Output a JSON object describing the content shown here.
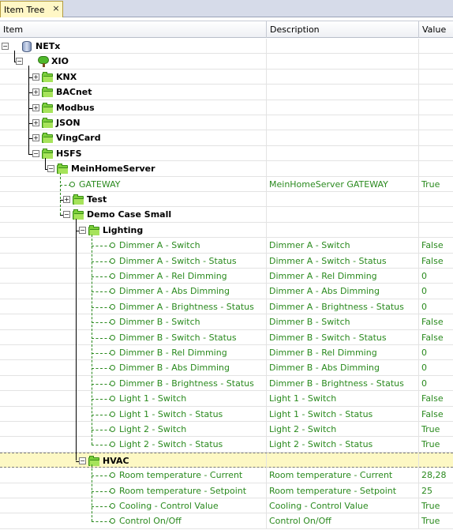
{
  "tab": {
    "title": "Item Tree",
    "close_glyph": "×"
  },
  "columns": {
    "item": "Item",
    "description": "Description",
    "value": "Value"
  },
  "rows": [
    {
      "label": "NETx",
      "desc": "",
      "value": "",
      "kind": "db",
      "level": 0,
      "expander": "−"
    },
    {
      "label": "XIO",
      "desc": "",
      "value": "",
      "kind": "tree",
      "level": 1,
      "expander": "−"
    },
    {
      "label": "KNX",
      "desc": "",
      "value": "",
      "kind": "folder",
      "level": 2,
      "expander": "+"
    },
    {
      "label": "BACnet",
      "desc": "",
      "value": "",
      "kind": "folder",
      "level": 2,
      "expander": "+"
    },
    {
      "label": "Modbus",
      "desc": "",
      "value": "",
      "kind": "folder",
      "level": 2,
      "expander": "+"
    },
    {
      "label": "JSON",
      "desc": "",
      "value": "",
      "kind": "folder",
      "level": 2,
      "expander": "+"
    },
    {
      "label": "VingCard",
      "desc": "",
      "value": "",
      "kind": "folder",
      "level": 2,
      "expander": "+"
    },
    {
      "label": "HSFS",
      "desc": "",
      "value": "",
      "kind": "folder",
      "level": 2,
      "expander": "−"
    },
    {
      "label": "MeinHomeServer",
      "desc": "",
      "value": "",
      "kind": "folder",
      "level": 3,
      "expander": "−"
    },
    {
      "label": "GATEWAY",
      "desc": "MeinHomeServer GATEWAY",
      "value": "True",
      "kind": "point",
      "level": 4
    },
    {
      "label": "Test",
      "desc": "",
      "value": "",
      "kind": "folder",
      "level": 4,
      "expander": "+"
    },
    {
      "label": "Demo Case Small",
      "desc": "",
      "value": "",
      "kind": "folder",
      "level": 4,
      "expander": "−"
    },
    {
      "label": "Lighting",
      "desc": "",
      "value": "",
      "kind": "folder",
      "level": 5,
      "expander": "−"
    },
    {
      "label": "Dimmer A - Switch",
      "desc": "Dimmer A - Switch",
      "value": "False",
      "kind": "point",
      "level": 6
    },
    {
      "label": "Dimmer A - Switch - Status",
      "desc": "Dimmer A - Switch - Status",
      "value": "False",
      "kind": "point",
      "level": 6
    },
    {
      "label": "Dimmer A - Rel Dimming",
      "desc": "Dimmer A - Rel Dimming",
      "value": "0",
      "kind": "point",
      "level": 6
    },
    {
      "label": "Dimmer A - Abs Dimming",
      "desc": "Dimmer A - Abs Dimming",
      "value": "0",
      "kind": "point",
      "level": 6
    },
    {
      "label": "Dimmer A - Brightness - Status",
      "desc": "Dimmer A - Brightness - Status",
      "value": "0",
      "kind": "point",
      "level": 6
    },
    {
      "label": "Dimmer B - Switch",
      "desc": "Dimmer B - Switch",
      "value": "False",
      "kind": "point",
      "level": 6
    },
    {
      "label": "Dimmer B - Switch - Status",
      "desc": "Dimmer B - Switch - Status",
      "value": "False",
      "kind": "point",
      "level": 6
    },
    {
      "label": "Dimmer B - Rel Dimming",
      "desc": "Dimmer B - Rel Dimming",
      "value": "0",
      "kind": "point",
      "level": 6
    },
    {
      "label": "Dimmer B - Abs Dimming",
      "desc": "Dimmer B - Abs Dimming",
      "value": "0",
      "kind": "point",
      "level": 6
    },
    {
      "label": "Dimmer B - Brightness - Status",
      "desc": "Dimmer B - Brightness - Status",
      "value": "0",
      "kind": "point",
      "level": 6
    },
    {
      "label": "Light 1 - Switch",
      "desc": "Light 1 - Switch",
      "value": "False",
      "kind": "point",
      "level": 6
    },
    {
      "label": "Light 1 - Switch - Status",
      "desc": "Light 1 - Switch - Status",
      "value": "False",
      "kind": "point",
      "level": 6
    },
    {
      "label": "Light 2 - Switch",
      "desc": "Light 2 - Switch",
      "value": "True",
      "kind": "point",
      "level": 6
    },
    {
      "label": "Light 2 - Switch - Status",
      "desc": "Light 2 - Switch - Status",
      "value": "True",
      "kind": "point",
      "level": 6
    },
    {
      "label": "HVAC",
      "desc": "",
      "value": "",
      "kind": "folder",
      "level": 5,
      "expander": "−",
      "selected": true
    },
    {
      "label": "Room temperature - Current",
      "desc": "Room temperature - Current",
      "value": "28,28",
      "kind": "point",
      "level": 6
    },
    {
      "label": "Room temperature - Setpoint",
      "desc": "Room temperature - Setpoint",
      "value": "25",
      "kind": "point",
      "level": 6
    },
    {
      "label": "Cooling - Control Value",
      "desc": "Cooling - Control Value",
      "value": "True",
      "kind": "point",
      "level": 6
    },
    {
      "label": "Control On/Off",
      "desc": "Control On/Off",
      "value": "True",
      "kind": "point",
      "level": 6
    }
  ]
}
